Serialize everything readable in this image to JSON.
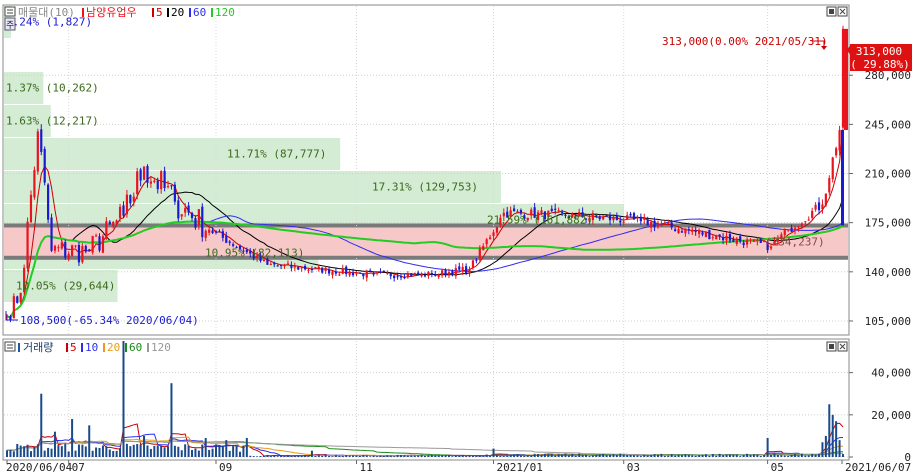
{
  "price_header": {
    "vol_profile_label": "매물대(10)",
    "stock_name": "남양유업우",
    "ma_5": "5",
    "ma_20": "20",
    "ma_60": "60",
    "ma_120": "120"
  },
  "volume_header": {
    "label": "거래량",
    "ma_5": "5",
    "ma_10": "10",
    "ma_20": "20",
    "ma_60": "60",
    "ma_120": "120"
  },
  "price_axis_ticks": [
    "105,000",
    "140,000",
    "175,000",
    "210,000",
    "245,000",
    "280,000"
  ],
  "price_badge": {
    "value": "313,000",
    "change": "( 29.88%)"
  },
  "volume_axis_ticks": [
    "0",
    "20,000",
    "40,000"
  ],
  "date_ticks": [
    {
      "label": "2020/06/04",
      "idx": 0
    },
    {
      "label": "07",
      "idx": 18
    },
    {
      "label": "09",
      "idx": 61
    },
    {
      "label": "11",
      "idx": 102
    },
    {
      "label": "2021/01",
      "idx": 142
    },
    {
      "label": "03",
      "idx": 180
    },
    {
      "label": "05",
      "idx": 222
    },
    {
      "label": "2021/06/07",
      "idx": 243
    }
  ],
  "annotations": {
    "high": "313,000(0.00% 2021/05/31)",
    "low": "108,500(-65.34% 2020/06/04)"
  },
  "colors": {
    "up": "#e8141e",
    "down": "#1a1ad0",
    "ma5": "#cc0000",
    "ma20": "#000000",
    "ma60": "#2e2ef0",
    "ma120": "#22cc22",
    "profile": "#d4ecd4",
    "profile_hl": "#f7c8c8",
    "profile_text": "#3a6a1a"
  },
  "chart_data": {
    "type": "candlestick",
    "title": "남양유업우",
    "ylim": [
      95000,
      330000
    ],
    "volume_ylim": [
      0,
      55000
    ],
    "key_points": [
      {
        "date": "2020/06/04",
        "close": 108500,
        "note": "low"
      },
      {
        "date": "2020/06/10",
        "close": 125000
      },
      {
        "date": "2020/06/17",
        "close": 240000
      },
      {
        "date": "2020/06/23",
        "close": 155000
      },
      {
        "date": "2020/07/09",
        "close": 155000
      },
      {
        "date": "2020/07/23",
        "close": 180000
      },
      {
        "date": "2020/07/31",
        "close": 215000
      },
      {
        "date": "2020/08/13",
        "close": 190000
      },
      {
        "date": "2020/08/28",
        "close": 170000
      },
      {
        "date": "2020/09/22",
        "close": 145000
      },
      {
        "date": "2020/11/10",
        "close": 138000
      },
      {
        "date": "2020/12/04",
        "close": 138000
      },
      {
        "date": "2020/12/21",
        "close": 142000
      },
      {
        "date": "2021/01/07",
        "close": 182000
      },
      {
        "date": "2021/02/05",
        "close": 180000
      },
      {
        "date": "2021/03/05",
        "close": 176000
      },
      {
        "date": "2021/04/08",
        "close": 165000
      },
      {
        "date": "2021/04/30",
        "close": 158000
      },
      {
        "date": "2021/05/07",
        "close": 170000
      },
      {
        "date": "2021/05/21",
        "close": 188000
      },
      {
        "date": "2021/05/28",
        "close": 241000
      },
      {
        "date": "2021/05/31",
        "close": 313000,
        "note": "high"
      }
    ],
    "volume_profile": [
      {
        "price_low": 95000,
        "price_high": 118500,
        "pct": "",
        "volume": ""
      },
      {
        "price_low": 118500,
        "price_high": 142000,
        "pct": "10.05%",
        "volume": "29,644"
      },
      {
        "price_low": 142000,
        "price_high": 165500,
        "pct": "10.95%",
        "volume": "82,113"
      },
      {
        "price_low": 165500,
        "price_high": 189000,
        "pct": "21.59%",
        "volume": "161,882"
      },
      {
        "price_low": 189000,
        "price_high": 212500,
        "pct": "17.31%",
        "volume": "129,753"
      },
      {
        "price_low": 212500,
        "price_high": 236000,
        "pct": "11.71%",
        "volume": "87,777"
      },
      {
        "price_low": 236000,
        "price_high": 259500,
        "pct": "1.63%",
        "volume": "12,217"
      },
      {
        "price_low": 259500,
        "price_high": 283000,
        "pct": "1.37%",
        "volume": "10,262"
      },
      {
        "price_low": 283000,
        "price_high": 306500,
        "pct": "",
        "volume": ""
      },
      {
        "price_low": 306500,
        "price_high": 330000,
        "pct": "0.24%",
        "volume": "1,827"
      }
    ],
    "highlighted_zone": {
      "price_low": 150000,
      "price_high": 173000,
      "label": "234,237"
    },
    "volume_spikes": [
      {
        "idx": 10,
        "volume": 30000
      },
      {
        "idx": 14,
        "volume": 12000
      },
      {
        "idx": 19,
        "volume": 18000
      },
      {
        "idx": 24,
        "volume": 15000
      },
      {
        "idx": 34,
        "volume": 55000
      },
      {
        "idx": 40,
        "volume": 10000
      },
      {
        "idx": 48,
        "volume": 35000
      },
      {
        "idx": 58,
        "volume": 9000
      },
      {
        "idx": 64,
        "volume": 8000
      },
      {
        "idx": 70,
        "volume": 9000
      },
      {
        "idx": 89,
        "volume": 3000
      },
      {
        "idx": 142,
        "volume": 4000
      },
      {
        "idx": 222,
        "volume": 9000
      },
      {
        "idx": 238,
        "volume": 7000
      },
      {
        "idx": 239,
        "volume": 10000
      },
      {
        "idx": 240,
        "volume": 25000
      },
      {
        "idx": 241,
        "volume": 20000
      },
      {
        "idx": 242,
        "volume": 17000
      },
      {
        "idx": 243,
        "volume": 8000
      }
    ]
  }
}
